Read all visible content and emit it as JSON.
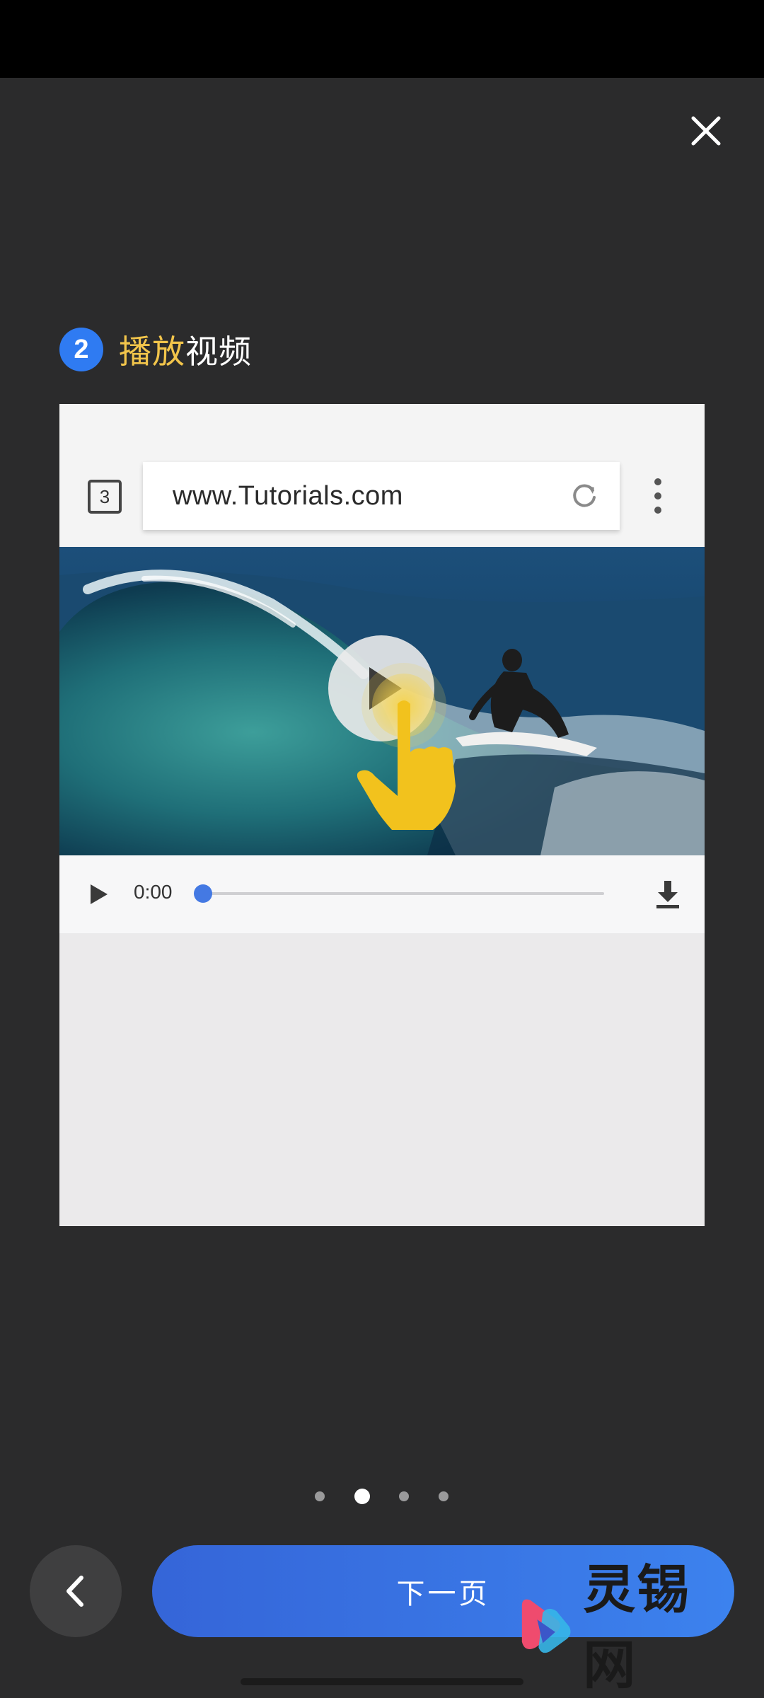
{
  "step": {
    "number": "2",
    "title_highlight": "播放",
    "title_rest": "视频"
  },
  "illustration": {
    "tab_count": "3",
    "url": "www.Tutorials.com",
    "video_time": "0:00"
  },
  "pagination": {
    "total": 4,
    "active_index": 1
  },
  "footer": {
    "next_label": "下一页"
  },
  "watermark": {
    "text": "灵锡网"
  },
  "colors": {
    "background": "#2b2b2c",
    "accent_blue": "#2f7bf2",
    "highlight_yellow": "#f2c54b",
    "button_gradient_start": "#3565d8",
    "button_gradient_end": "#3c82ee"
  },
  "icons": {
    "close": "close-icon",
    "back": "chevron-left-icon",
    "reload": "reload-icon",
    "menu": "more-vert-icon",
    "play": "play-icon",
    "download": "download-icon",
    "hand": "tap-hand-icon"
  }
}
